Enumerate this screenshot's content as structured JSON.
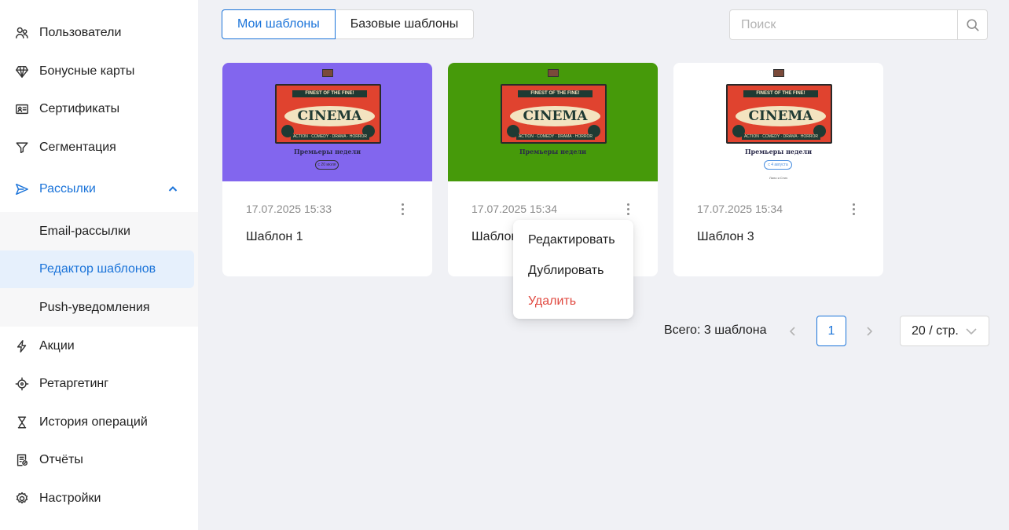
{
  "sidebar": {
    "items": [
      {
        "label": "Пользователи",
        "icon": "users-icon"
      },
      {
        "label": "Бонусные карты",
        "icon": "diamond-icon"
      },
      {
        "label": "Сертификаты",
        "icon": "id-card-icon"
      },
      {
        "label": "Сегментация",
        "icon": "filter-icon"
      },
      {
        "label": "Рассылки",
        "icon": "send-icon"
      },
      {
        "label": "Акции",
        "icon": "lightning-icon"
      },
      {
        "label": "Ретаргетинг",
        "icon": "target-icon"
      },
      {
        "label": "История операций",
        "icon": "hourglass-icon"
      },
      {
        "label": "Отчёты",
        "icon": "report-icon"
      },
      {
        "label": "Настройки",
        "icon": "gear-icon"
      }
    ],
    "subitems": [
      {
        "label": "Email-рассылки"
      },
      {
        "label": "Редактор шаблонов",
        "selected": true
      },
      {
        "label": "Push-уведомления"
      }
    ],
    "active_color": "#1a73d9"
  },
  "tabs": [
    {
      "label": "Мои шаблоны",
      "active": true
    },
    {
      "label": "Базовые шаблоны",
      "active": false
    }
  ],
  "search": {
    "placeholder": "Поиск",
    "value": ""
  },
  "cards": [
    {
      "date": "17.07.2025 15:33",
      "title": "Шаблон 1",
      "bg": "#8266ee",
      "preview": {
        "band": "FINEST OF THE FINE!",
        "cinema": "CINEMA",
        "strip": "ACTION · COMEDY · DRAMA · HORROR",
        "headline": "Премьеры недели",
        "pill": "с 20 июля"
      }
    },
    {
      "date": "17.07.2025 15:34",
      "title": "Шаблон 2",
      "bg": "#469a0a",
      "preview": {
        "band": "FINEST OF THE FINE!",
        "cinema": "CINEMA",
        "strip": "ACTION · COMEDY · DRAMA · HORROR",
        "headline": "Премьеры недели",
        "pill": ""
      }
    },
    {
      "date": "17.07.2025 15:34",
      "title": "Шаблон 3",
      "bg": "#ffffff",
      "preview": {
        "band": "FINEST OF THE FINE!",
        "cinema": "CINEMA",
        "strip": "ACTION · COMEDY · DRAMA · HORROR",
        "headline": "Премьеры недели",
        "pill": "с 4 августа",
        "footer": "Лило и Стич"
      }
    }
  ],
  "context_menu": {
    "items": [
      "Редактировать",
      "Дублировать",
      "Удалить"
    ],
    "danger_color": "#e0483f"
  },
  "pagination": {
    "total_label": "Всего: 3 шаблона",
    "current_page": "1",
    "page_size": "20 / стр."
  }
}
